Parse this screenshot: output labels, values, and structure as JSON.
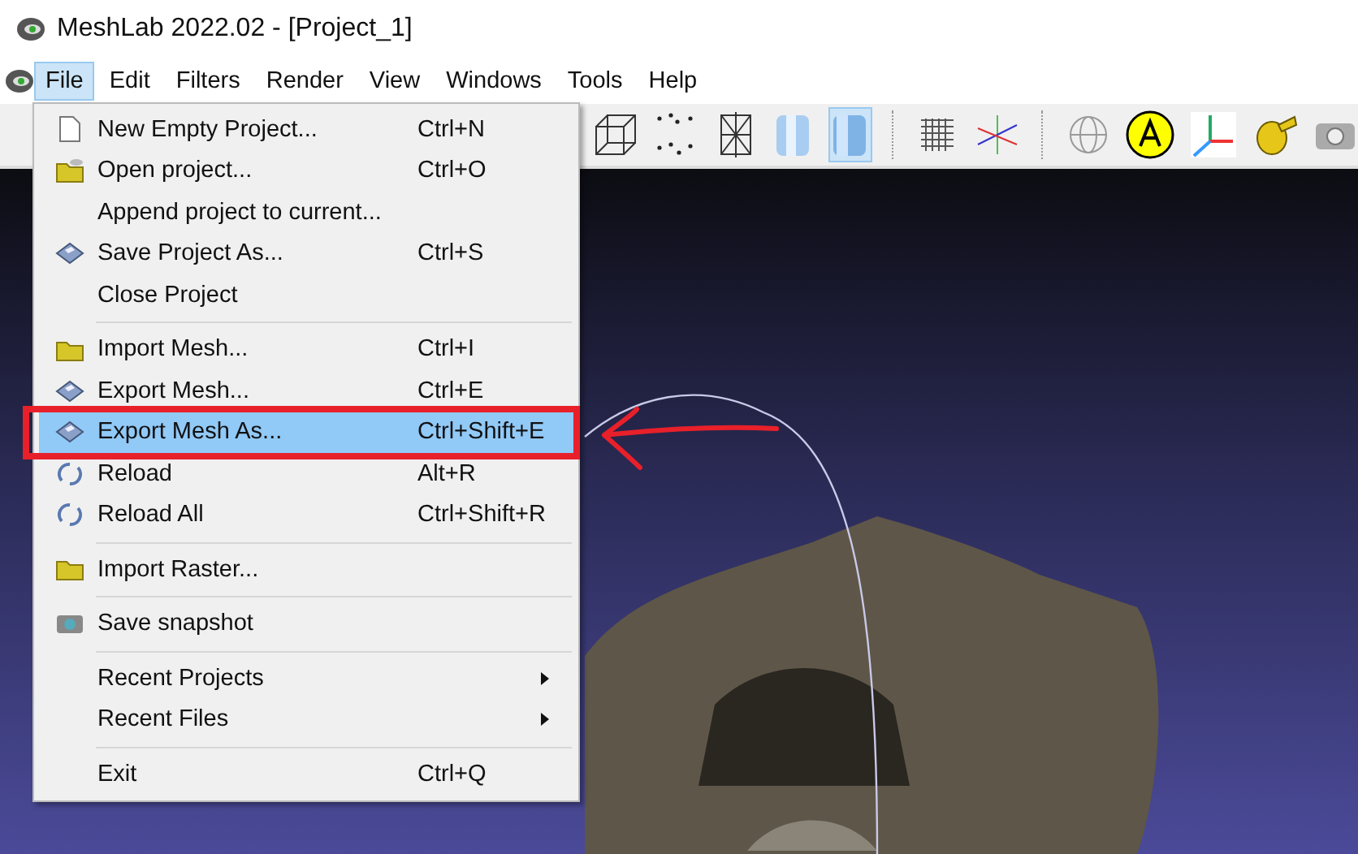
{
  "window": {
    "title": "MeshLab 2022.02 - [Project_1]"
  },
  "menubar": [
    {
      "label": "File",
      "selected": true
    },
    {
      "label": "Edit",
      "selected": false
    },
    {
      "label": "Filters",
      "selected": false
    },
    {
      "label": "Render",
      "selected": false
    },
    {
      "label": "View",
      "selected": false
    },
    {
      "label": "Windows",
      "selected": false
    },
    {
      "label": "Tools",
      "selected": false
    },
    {
      "label": "Help",
      "selected": false
    }
  ],
  "toolbar": [
    {
      "selected": false
    },
    {
      "selected": false
    },
    {
      "selected": false
    },
    {
      "selected": false
    },
    {
      "selected": true
    }
  ],
  "file_menu": [
    {
      "kind": "item",
      "label": "New Empty Project...",
      "shortcut": "Ctrl+N",
      "selected": false
    },
    {
      "kind": "item",
      "label": "Open project...",
      "shortcut": "Ctrl+O",
      "selected": false
    },
    {
      "kind": "item",
      "label": "Append project to current...",
      "selected": false
    },
    {
      "kind": "item",
      "label": "Save Project As...",
      "shortcut": "Ctrl+S",
      "selected": false
    },
    {
      "kind": "item",
      "label": "Close Project",
      "selected": false
    },
    {
      "kind": "separator"
    },
    {
      "kind": "item",
      "label": "Import Mesh...",
      "shortcut": "Ctrl+I",
      "selected": false
    },
    {
      "kind": "item",
      "label": "Export Mesh...",
      "shortcut": "Ctrl+E",
      "selected": false
    },
    {
      "kind": "item",
      "label": "Export Mesh As...",
      "shortcut": "Ctrl+Shift+E",
      "selected": true
    },
    {
      "kind": "item",
      "label": "Reload",
      "shortcut": "Alt+R",
      "selected": false
    },
    {
      "kind": "item",
      "label": "Reload All",
      "shortcut": "Ctrl+Shift+R",
      "selected": false
    },
    {
      "kind": "separator"
    },
    {
      "kind": "item",
      "label": "Import Raster...",
      "selected": false
    },
    {
      "kind": "separator"
    },
    {
      "kind": "item",
      "label": "Save snapshot",
      "selected": false
    },
    {
      "kind": "separator"
    },
    {
      "kind": "submenu",
      "label": "Recent Projects",
      "selected": false
    },
    {
      "kind": "submenu",
      "label": "Recent Files",
      "selected": false
    },
    {
      "kind": "separator"
    },
    {
      "kind": "item",
      "label": "Exit",
      "shortcut": "Ctrl+Q",
      "selected": false
    }
  ]
}
